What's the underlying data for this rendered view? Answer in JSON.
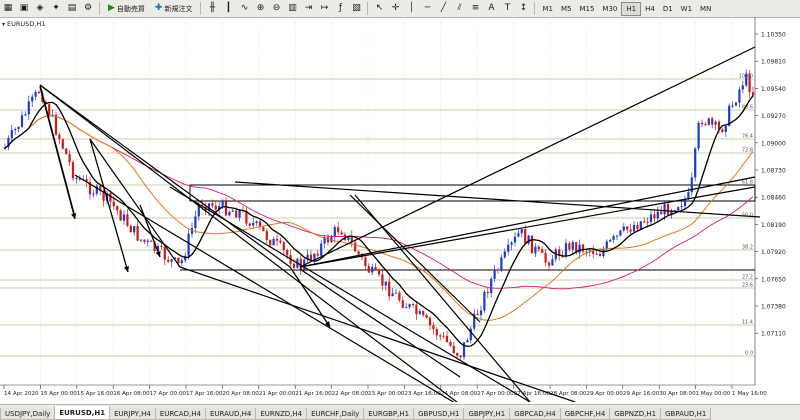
{
  "toolbar": {
    "auto_trade_label": "自動売買",
    "new_order_label": "新規注文",
    "timeframes": [
      "M1",
      "M5",
      "M15",
      "M30",
      "H1",
      "H4",
      "D1",
      "W1",
      "MN"
    ],
    "active_timeframe": "H1"
  },
  "chart": {
    "title": "EURUSD,H1",
    "price_ticks": [
      "1.10350",
      "1.09810",
      "1.09540",
      "1.09270",
      "1.09000",
      "1.08730",
      "1.08460",
      "1.08190",
      "1.07920",
      "1.07650",
      "1.07380",
      "1.07110"
    ],
    "date_ticks": [
      "14 Apr 2020",
      "15 Apr 00:00",
      "15 Apr 16:00",
      "16 Apr 08:00",
      "17 Apr 00:00",
      "17 Apr 16:00",
      "20 Apr 08:00",
      "21 Apr 00:00",
      "21 Apr 16:00",
      "22 Apr 08:00",
      "23 Apr 00:00",
      "23 Apr 16:00",
      "24 Apr 08:00",
      "27 Apr 00:00",
      "27 Apr 16:00",
      "28 Apr 08:00",
      "29 Apr 00:00",
      "29 Apr 16:00",
      "30 Apr 08:00",
      "1 May 00:00",
      "1 May 16:00"
    ],
    "fib_labels": [
      "100.0",
      "88.6",
      "76.4",
      "72.8",
      "61.8",
      "50.0",
      "38.2",
      "27.2",
      "23.6",
      "11.4",
      "0.0"
    ],
    "colors": {
      "bull": "#1a3cc8",
      "bear": "#c81a1a",
      "ma_black": "#000000",
      "ma_orange": "#e07a1a",
      "ma_pink": "#d81a7a",
      "fib": "#9a9a60"
    }
  },
  "tabs": [
    "USDJPY,Daily",
    "EURUSD,H1",
    "EURJPY,H4",
    "EURCAD,H4",
    "EURAUD,H4",
    "EURNZD,H4",
    "EURCHF,Daily",
    "EURGBP,H1",
    "GBPUSD,H1",
    "GBPJPY,H1",
    "GBPCAD,H4",
    "GBPCHF,H4",
    "GBPNZD,H1",
    "GBPAUD,H1"
  ],
  "active_tab": "EURUSD,H1"
}
